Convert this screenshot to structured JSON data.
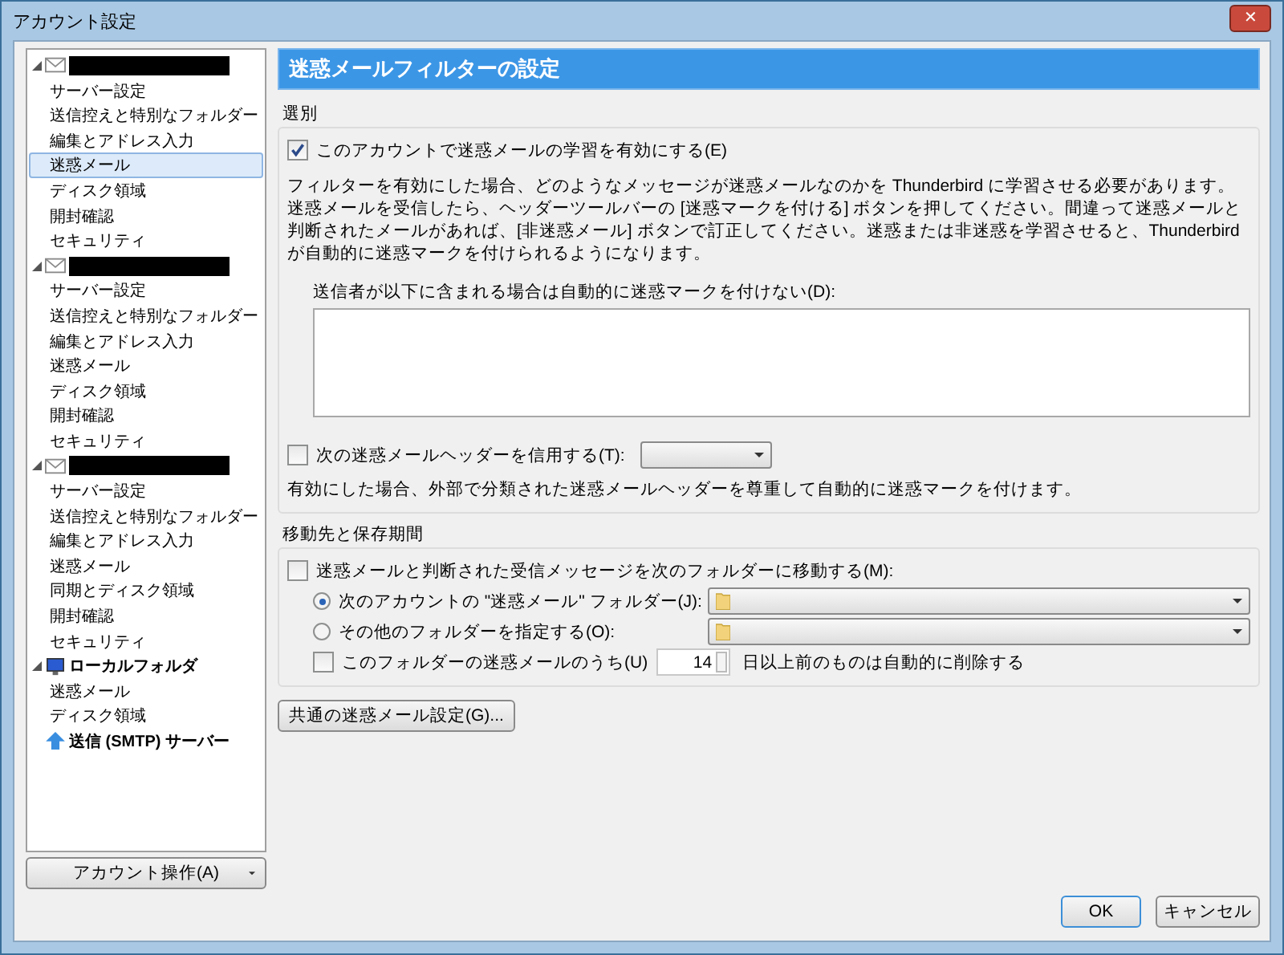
{
  "window": {
    "title": "アカウント設定",
    "close": "✕"
  },
  "sidebar": {
    "tree": [
      {
        "kind": "mail",
        "expanded": true,
        "redacted": true,
        "children": [
          {
            "label": "サーバー設定",
            "selected": false
          },
          {
            "label": "送信控えと特別なフォルダー",
            "selected": false
          },
          {
            "label": "編集とアドレス入力",
            "selected": false
          },
          {
            "label": "迷惑メール",
            "selected": true
          },
          {
            "label": "ディスク領域",
            "selected": false
          },
          {
            "label": "開封確認",
            "selected": false
          },
          {
            "label": "セキュリティ",
            "selected": false
          }
        ]
      },
      {
        "kind": "mail",
        "expanded": true,
        "redacted": true,
        "children": [
          {
            "label": "サーバー設定",
            "selected": false
          },
          {
            "label": "送信控えと特別なフォルダー",
            "selected": false
          },
          {
            "label": "編集とアドレス入力",
            "selected": false
          },
          {
            "label": "迷惑メール",
            "selected": false
          },
          {
            "label": "ディスク領域",
            "selected": false
          },
          {
            "label": "開封確認",
            "selected": false
          },
          {
            "label": "セキュリティ",
            "selected": false
          }
        ]
      },
      {
        "kind": "mail",
        "expanded": true,
        "redacted": true,
        "children": [
          {
            "label": "サーバー設定",
            "selected": false
          },
          {
            "label": "送信控えと特別なフォルダー",
            "selected": false
          },
          {
            "label": "編集とアドレス入力",
            "selected": false
          },
          {
            "label": "迷惑メール",
            "selected": false
          },
          {
            "label": "同期とディスク領域",
            "selected": false
          },
          {
            "label": "開封確認",
            "selected": false
          },
          {
            "label": "セキュリティ",
            "selected": false
          }
        ]
      },
      {
        "kind": "local",
        "expanded": true,
        "label": "ローカルフォルダ",
        "children": [
          {
            "label": "迷惑メール",
            "selected": false
          },
          {
            "label": "ディスク領域",
            "selected": false
          }
        ]
      },
      {
        "kind": "smtp",
        "label": "送信 (SMTP) サーバー"
      }
    ],
    "actions_button": "アカウント操作(A)"
  },
  "header": "迷惑メールフィルターの設定",
  "filtering": {
    "legend": "選別",
    "enable": {
      "label": "このアカウントで迷惑メールの学習を有効にする(E)",
      "checked": true
    },
    "description": "フィルターを有効にした場合、どのようなメッセージが迷惑メールなのかを Thunderbird に学習させる必要があります。迷惑メールを受信したら、ヘッダーツールバーの [迷惑マークを付ける] ボタンを押してください。間違って迷惑メールと判断されたメールがあれば、[非迷惑メール] ボタンで訂正してください。迷惑または非迷惑を学習させると、Thunderbird が自動的に迷惑マークを付けられるようになります。",
    "whitelist_label": "送信者が以下に含まれる場合は自動的に迷惑マークを付けない(D):",
    "trust_headers": {
      "label": "次の迷惑メールヘッダーを信用する(T):",
      "checked": false
    },
    "trust_note": "有効にした場合、外部で分類された迷惑メールヘッダーを尊重して自動的に迷惑マークを付けます。"
  },
  "destination": {
    "legend": "移動先と保存期間",
    "move": {
      "label": "迷惑メールと判断された受信メッセージを次のフォルダーに移動する(M):",
      "checked": false
    },
    "options": [
      {
        "label": "次のアカウントの \"迷惑メール\" フォルダー(J):",
        "selected": true
      },
      {
        "label": "その他のフォルダーを指定する(O):",
        "selected": false
      }
    ],
    "purge": {
      "label": "このフォルダーの迷惑メールのうち(U)",
      "checked": false,
      "days": "14",
      "suffix": "日以上前のものは自動的に削除する"
    }
  },
  "global_button": "共通の迷惑メール設定(G)...",
  "buttons": [
    {
      "label": "OK",
      "kind": "default"
    },
    {
      "label": "キャンセル",
      "kind": "normal"
    }
  ]
}
